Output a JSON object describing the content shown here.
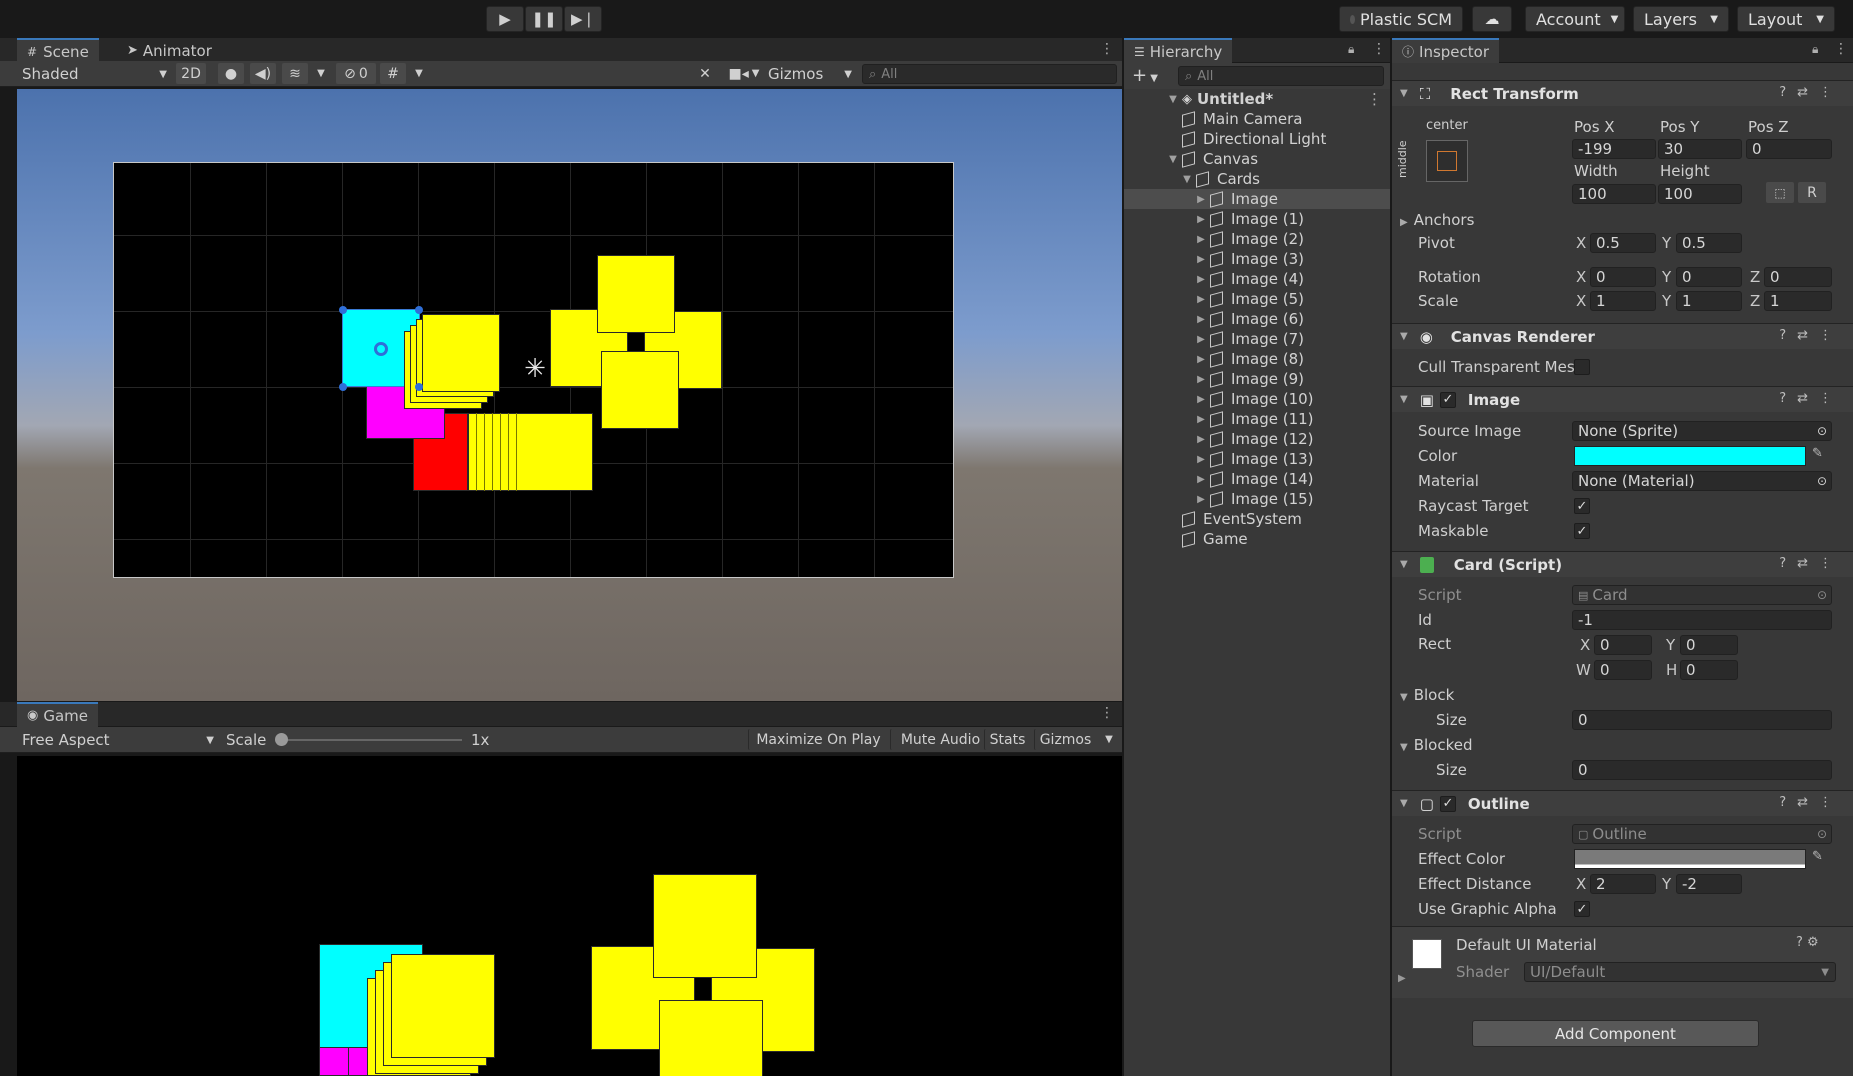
{
  "toolbar": {
    "play_icon": "play-icon",
    "pause_icon": "pause-icon",
    "step_icon": "step-icon",
    "plastic_scm": "Plastic SCM",
    "account": "Account",
    "layers": "Layers",
    "layout": "Layout"
  },
  "scene_panel": {
    "tabs": [
      "Scene",
      "Animator"
    ],
    "shading": "Shaded",
    "mode_2d": "2D",
    "hidden_count": "0",
    "gizmos": "Gizmos",
    "search_placeholder": "All"
  },
  "game_panel": {
    "tab": "Game",
    "aspect": "Free Aspect",
    "scale_label": "Scale",
    "scale_value": "1x",
    "maximize": "Maximize On Play",
    "mute": "Mute Audio",
    "stats": "Stats",
    "gizmos": "Gizmos"
  },
  "hierarchy": {
    "tab": "Hierarchy",
    "search_placeholder": "All",
    "scene": "Untitled*",
    "items": [
      {
        "label": "Main Camera"
      },
      {
        "label": "Directional Light"
      },
      {
        "label": "Canvas"
      },
      {
        "label": "Cards"
      },
      {
        "label": "Image"
      },
      {
        "label": "Image (1)"
      },
      {
        "label": "Image (2)"
      },
      {
        "label": "Image (3)"
      },
      {
        "label": "Image (4)"
      },
      {
        "label": "Image (5)"
      },
      {
        "label": "Image (6)"
      },
      {
        "label": "Image (7)"
      },
      {
        "label": "Image (8)"
      },
      {
        "label": "Image (9)"
      },
      {
        "label": "Image (10)"
      },
      {
        "label": "Image (11)"
      },
      {
        "label": "Image (12)"
      },
      {
        "label": "Image (13)"
      },
      {
        "label": "Image (14)"
      },
      {
        "label": "Image (15)"
      },
      {
        "label": "EventSystem"
      },
      {
        "label": "Game"
      }
    ]
  },
  "inspector": {
    "tab": "Inspector",
    "rect_transform": {
      "title": "Rect Transform",
      "anchor_h": "center",
      "anchor_v": "middle",
      "pos_x_label": "Pos X",
      "pos_y_label": "Pos Y",
      "pos_z_label": "Pos Z",
      "pos_x": "-199",
      "pos_y": "30",
      "pos_z": "0",
      "width_label": "Width",
      "height_label": "Height",
      "width": "100",
      "height": "100",
      "raw_btn": "R",
      "anchors": "Anchors",
      "pivot": "Pivot",
      "pivot_x": "0.5",
      "pivot_y": "0.5",
      "rotation": "Rotation",
      "rot_x": "0",
      "rot_y": "0",
      "rot_z": "0",
      "scale": "Scale",
      "scale_x": "1",
      "scale_y": "1",
      "scale_z": "1"
    },
    "canvas_renderer": {
      "title": "Canvas Renderer",
      "cull": "Cull Transparent Mesl"
    },
    "image": {
      "title": "Image",
      "source_label": "Source Image",
      "source": "None (Sprite)",
      "color_label": "Color",
      "color": "#00ffff",
      "material_label": "Material",
      "material": "None (Material)",
      "raycast": "Raycast Target",
      "maskable": "Maskable"
    },
    "card_script": {
      "title": "Card (Script)",
      "script_label": "Script",
      "script": "Card",
      "id_label": "Id",
      "id": "-1",
      "rect_label": "Rect",
      "rx": "0",
      "ry": "0",
      "rw": "0",
      "rh": "0",
      "block": "Block",
      "block_size_label": "Size",
      "block_size": "0",
      "blocked": "Blocked",
      "blocked_size_label": "Size",
      "blocked_size": "0"
    },
    "outline": {
      "title": "Outline",
      "script_label": "Script",
      "script": "Outline",
      "effect_color_label": "Effect Color",
      "effect_distance_label": "Effect Distance",
      "dist_x": "2",
      "dist_y": "-2",
      "use_alpha": "Use Graphic Alpha"
    },
    "material": {
      "name": "Default UI Material",
      "shader_label": "Shader",
      "shader": "UI/Default"
    },
    "add_component": "Add Component"
  },
  "colors": {
    "cyan": "#00ffff",
    "magenta": "#ff00ff",
    "red": "#ff0000",
    "yellow": "#ffff00",
    "accent": "#3a79bb"
  }
}
